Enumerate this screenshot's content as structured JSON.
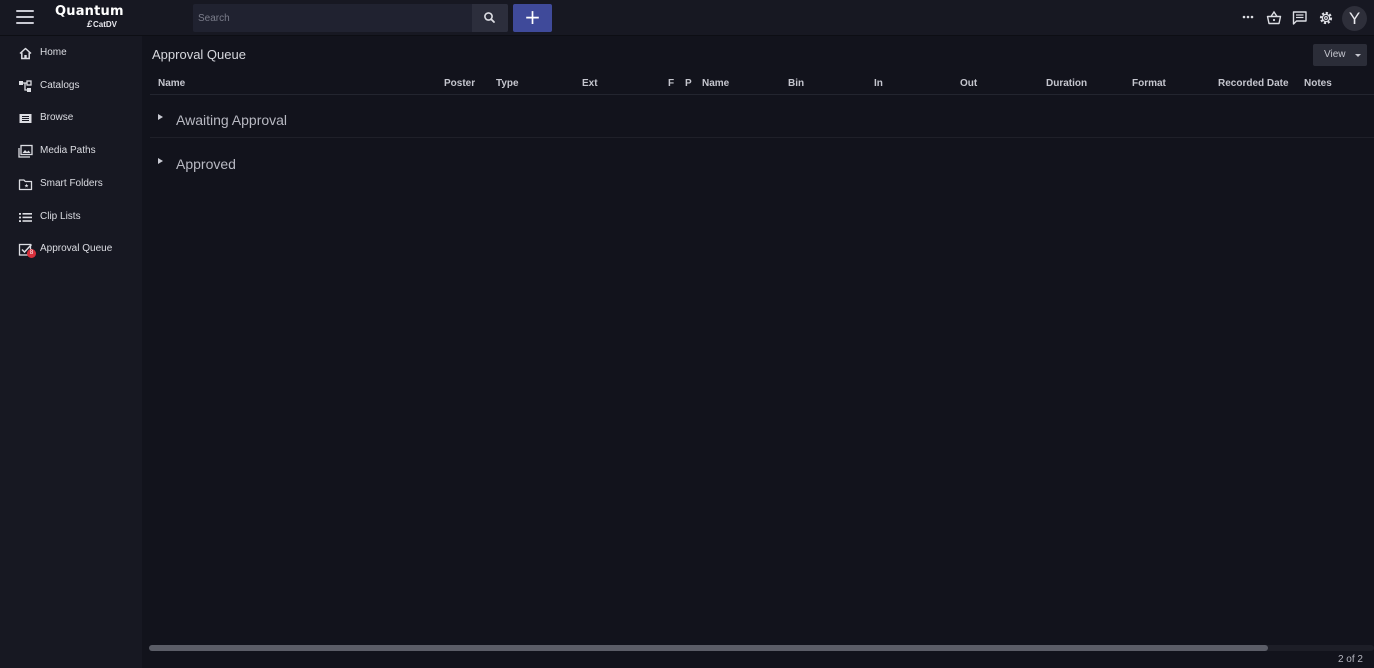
{
  "app": {
    "brand": "Quantum",
    "sub_brand": "CatDV",
    "sub_mark": "£"
  },
  "search": {
    "placeholder": "Search",
    "value": ""
  },
  "toolbar": {
    "add_label": "+",
    "user_initial": "Y"
  },
  "sidebar": {
    "items": [
      {
        "label": "Home",
        "icon": "home-icon"
      },
      {
        "label": "Catalogs",
        "icon": "catalogs-icon"
      },
      {
        "label": "Browse",
        "icon": "browse-icon"
      },
      {
        "label": "Media Paths",
        "icon": "media-paths-icon"
      },
      {
        "label": "Smart Folders",
        "icon": "smart-folder-icon"
      },
      {
        "label": "Clip Lists",
        "icon": "list-icon"
      },
      {
        "label": "Approval Queue",
        "icon": "approval-icon",
        "badge": "8"
      }
    ]
  },
  "main": {
    "title": "Approval Queue",
    "view_label": "View",
    "columns": [
      "Name",
      "Poster",
      "Type",
      "Ext",
      "F",
      "P",
      "Name",
      "Bin",
      "In",
      "Out",
      "Duration",
      "Format",
      "Recorded Date",
      "Notes"
    ],
    "groups": [
      {
        "label": "Awaiting Approval"
      },
      {
        "label": "Approved"
      }
    ],
    "pager": "2 of 2"
  },
  "colors": {
    "background": "#12131c",
    "sidebar": "#171822",
    "accent": "#3f4a9a",
    "badge": "#d8303c"
  }
}
